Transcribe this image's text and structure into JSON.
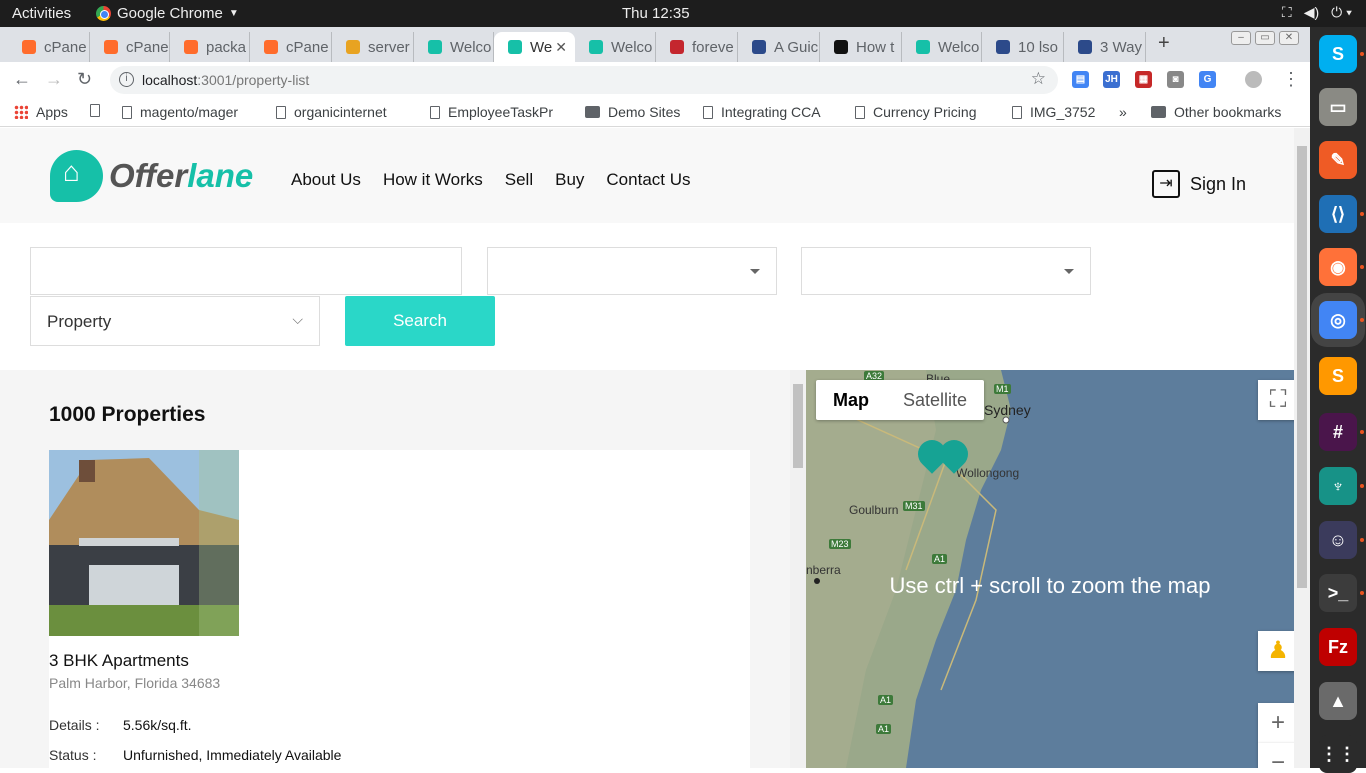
{
  "system_bar": {
    "activities": "Activities",
    "app_name": "Google Chrome",
    "clock": "Thu 12:35"
  },
  "browser": {
    "tabs": [
      {
        "label": "cPane",
        "icon": "cpanel-icon",
        "color": "#ff6c2c"
      },
      {
        "label": "cPane",
        "icon": "cpanel-icon",
        "color": "#ff6c2c"
      },
      {
        "label": "packa",
        "icon": "cpanel-icon",
        "color": "#ff6c2c"
      },
      {
        "label": "cPane",
        "icon": "cpanel-icon",
        "color": "#ff6c2c"
      },
      {
        "label": "server",
        "icon": "server-icon",
        "color": "#e8a321"
      },
      {
        "label": "Welco",
        "icon": "offerlane-icon",
        "color": "#16c0a8"
      },
      {
        "label": "We",
        "icon": "offerlane-icon",
        "color": "#16c0a8",
        "active": true
      },
      {
        "label": "Welco",
        "icon": "offerlane-icon",
        "color": "#16c0a8"
      },
      {
        "label": "foreve",
        "icon": "n-icon",
        "color": "#c4262e"
      },
      {
        "label": "A Guic",
        "icon": "shield-icon",
        "color": "#2c4a8a"
      },
      {
        "label": "How t",
        "icon": "htg-icon",
        "color": "#111111"
      },
      {
        "label": "Welco",
        "icon": "offerlane-icon",
        "color": "#16c0a8"
      },
      {
        "label": "10 lso",
        "icon": "shield-icon",
        "color": "#2c4a8a"
      },
      {
        "label": "3 Way",
        "icon": "shield-icon",
        "color": "#2c4a8a"
      }
    ],
    "url_host": "localhost",
    "url_rest": ":3001/property-list",
    "bookmarks": [
      {
        "label": "Apps",
        "type": "apps"
      },
      {
        "label": "",
        "type": "doc"
      },
      {
        "label": "magento/mager",
        "type": "doc"
      },
      {
        "label": "organicinternet",
        "type": "doc"
      },
      {
        "label": "EmployeeTaskPr",
        "type": "doc"
      },
      {
        "label": "Demo Sites",
        "type": "folder"
      },
      {
        "label": "Integrating CCA",
        "type": "doc"
      },
      {
        "label": "Currency Pricing",
        "type": "doc"
      },
      {
        "label": "IMG_3752",
        "type": "doc"
      }
    ],
    "bookmarks_overflow": "»",
    "other_bookmarks": "Other bookmarks"
  },
  "site": {
    "brand_a": "Offer",
    "brand_b": "lane",
    "brand_color": "#16c0a8",
    "nav": [
      "About Us",
      "How it Works",
      "Sell",
      "Buy",
      "Contact Us"
    ],
    "sign_in": "Sign In"
  },
  "search": {
    "keyword_value": "",
    "select_1_value": "",
    "select_2_value": "",
    "type_value": "Property",
    "button": "Search",
    "button_color": "#2ad7c8"
  },
  "results": {
    "count_label": "1000 Properties",
    "listing": {
      "title": "3 BHK Apartments",
      "address": "Palm Harbor, Florida 34683",
      "details_key": "Details :",
      "details_value": "5.56k/sq.ft.",
      "status_key": "Status :",
      "status_value": "Unfurnished, Immediately Available"
    }
  },
  "map": {
    "type_map": "Map",
    "type_satellite": "Satellite",
    "hint": "Use ctrl + scroll to zoom the map",
    "places": [
      "Sydney",
      "Wollongong",
      "Goulburn",
      "nberra",
      "Blue"
    ],
    "roads": [
      "A32",
      "M1",
      "M31",
      "M23",
      "A1",
      "A1",
      "A1"
    ],
    "zoom_in": "+",
    "zoom_out": "−"
  },
  "dock": [
    {
      "name": "skype-icon",
      "color": "#00aff0",
      "glyph": "S"
    },
    {
      "name": "files-icon",
      "color": "#8a8a84",
      "glyph": "▭"
    },
    {
      "name": "postman-icon",
      "color": "#ef5b25",
      "glyph": "✎"
    },
    {
      "name": "vscode-icon",
      "color": "#1f6fb5",
      "glyph": "⟨⟩"
    },
    {
      "name": "firefox-icon",
      "color": "#ff7139",
      "glyph": "◉"
    },
    {
      "name": "chrome-icon",
      "color": "#4285f4",
      "glyph": "◎"
    },
    {
      "name": "sublime-icon",
      "color": "#ff9800",
      "glyph": "S"
    },
    {
      "name": "slack-icon",
      "color": "#4a154b",
      "glyph": "#"
    },
    {
      "name": "gitkraken-icon",
      "color": "#179287",
      "glyph": "♆"
    },
    {
      "name": "tor-icon",
      "color": "#3b3b5c",
      "glyph": "☺"
    },
    {
      "name": "terminal-icon",
      "color": "#3c3c3c",
      "glyph": ">_"
    },
    {
      "name": "filezilla-icon",
      "color": "#bf0000",
      "glyph": "Fz"
    },
    {
      "name": "installer-icon",
      "color": "#6a6a6a",
      "glyph": "▲"
    },
    {
      "name": "app-grid-icon",
      "color": "#2b2b2b",
      "glyph": "⋮⋮"
    }
  ]
}
